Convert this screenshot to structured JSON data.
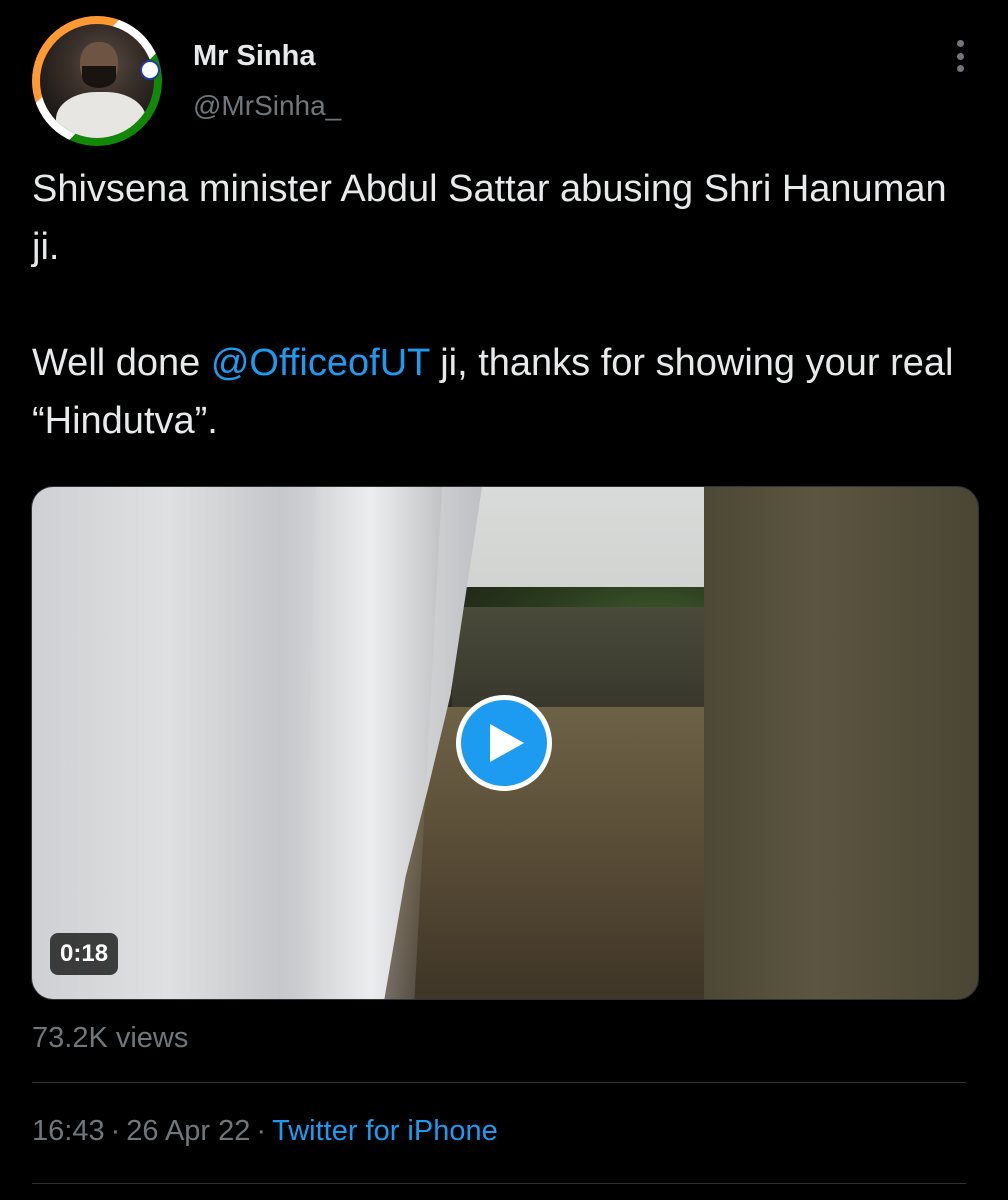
{
  "author": {
    "name": "Mr Sinha",
    "handle": "@MrSinha_",
    "avatar_icon": "profile-photo-avatar"
  },
  "menu": {
    "icon": "more-vertical-icon"
  },
  "tweet": {
    "line1": "Shivsena minister Abdul Sattar abusing Shri Hanuman ji.",
    "line2_prefix": "Well done ",
    "mention": "@OfficeofUT",
    "line2_suffix": " ji, thanks for showing your real “Hindutva”."
  },
  "media": {
    "type": "video",
    "duration": "0:18",
    "play_icon": "play-icon"
  },
  "stats": {
    "views": "73.2K views"
  },
  "meta": {
    "time": "16:43",
    "date": "26 Apr 22",
    "separator": "·",
    "source": "Twitter for iPhone"
  },
  "colors": {
    "background": "#000000",
    "text": "#e7e9ea",
    "secondary_text": "#71767b",
    "accent": "#1d9bf0"
  }
}
